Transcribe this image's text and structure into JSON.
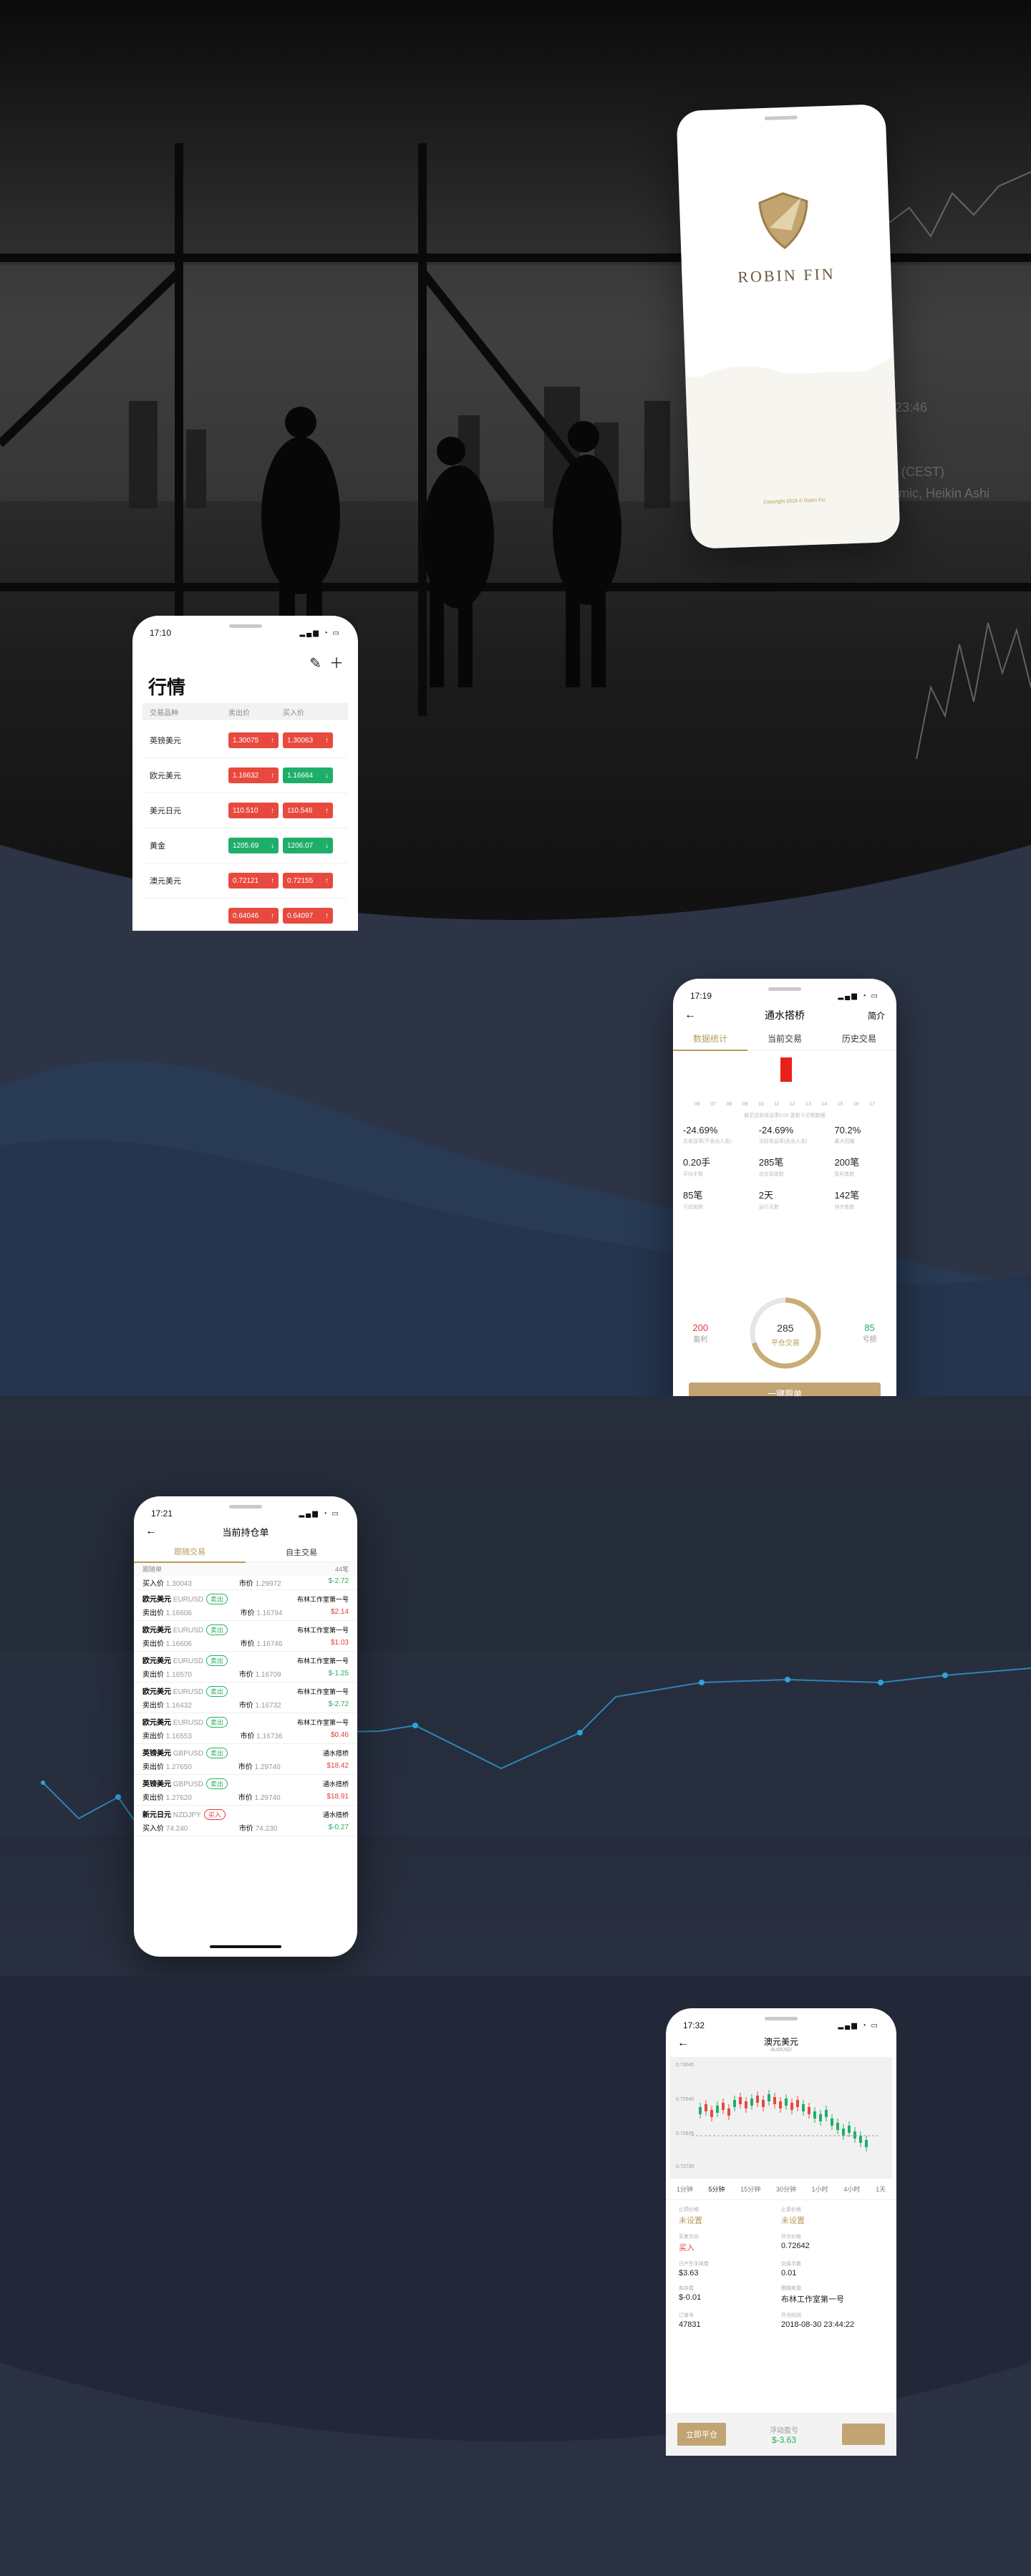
{
  "brand": {
    "name": "ROBIN FIN",
    "copyright": "Copyright 2018 © Robin Fin",
    "accent": "#b89a5c"
  },
  "backdrop": {
    "ticker": "23:46",
    "label1": "rithmic, Heikin Ashi",
    "label2": "gju (CEST)"
  },
  "market": {
    "time": "17:10",
    "title": "行情",
    "columns": [
      "交易品种",
      "卖出价",
      "买入价"
    ],
    "rows": [
      {
        "name": "英镑美元",
        "sell": "1.30075",
        "buy": "1.30063",
        "sell_dir": "↑",
        "buy_dir": "↑",
        "sell_c": "r",
        "buy_c": "r"
      },
      {
        "name": "欧元美元",
        "sell": "1.16632",
        "buy": "1.16664",
        "sell_dir": "↑",
        "buy_dir": "↓",
        "sell_c": "r",
        "buy_c": "g"
      },
      {
        "name": "美元日元",
        "sell": "110.510",
        "buy": "110.546",
        "sell_dir": "↑",
        "buy_dir": "↑",
        "sell_c": "r",
        "buy_c": "r"
      },
      {
        "name": "黄金",
        "sell": "1205.69",
        "buy": "1206.07",
        "sell_dir": "↓",
        "buy_dir": "↓",
        "sell_c": "g",
        "buy_c": "g"
      },
      {
        "name": "澳元美元",
        "sell": "0.72121",
        "buy": "0.72155",
        "sell_dir": "↑",
        "buy_dir": "↑",
        "sell_c": "r",
        "buy_c": "r"
      },
      {
        "name": "",
        "sell": "0.64046",
        "buy": "0.64097",
        "sell_dir": "↑",
        "buy_dir": "↑",
        "sell_c": "r",
        "buy_c": "r"
      }
    ]
  },
  "detail": {
    "time": "17:19",
    "title": "通水搭桥",
    "intro": "简介",
    "tabs": [
      "数据统计",
      "当前交易",
      "历史交易"
    ],
    "chart_note": "截至目前收益率0.00 更新于近期数据",
    "axis": [
      "06",
      "07",
      "08",
      "09",
      "10",
      "11",
      "12",
      "13",
      "14",
      "15",
      "16",
      "17"
    ],
    "stats": [
      {
        "v": "-24.69%",
        "l": "总收益率(不含出入金)"
      },
      {
        "v": "-24.69%",
        "l": "当前收益率(含出入金)"
      },
      {
        "v": "70.2%",
        "l": "最大回撤"
      },
      {
        "v": "0.20手",
        "l": "平均手数"
      },
      {
        "v": "285笔",
        "l": "总交易笔数"
      },
      {
        "v": "200笔",
        "l": "盈利笔数"
      },
      {
        "v": "85笔",
        "l": "亏损笔数"
      },
      {
        "v": "2天",
        "l": "运行天数"
      },
      {
        "v": "142笔",
        "l": "持仓笔数"
      }
    ],
    "ring_left": "200",
    "ring_left_l": "盈利",
    "ring_center": "285",
    "ring_center_l": "平仓交易",
    "ring_right": "85",
    "ring_right_l": "亏损",
    "ring_ratio": 0.7,
    "cta": "一键跟单"
  },
  "positions": {
    "time": "17:21",
    "title": "当前持仓单",
    "tabs": [
      "跟随交易",
      "自主交易"
    ],
    "header_l": "跟随单",
    "header_r": "44笔",
    "first": {
      "side": "买入价",
      "price": "1.30043",
      "type": "市价",
      "p2": "1.29972",
      "pl": "$-2.72"
    },
    "items": [
      {
        "name": "欧元美元",
        "code": "EURUSD",
        "tag": "卖出",
        "from": "布林工作室第一号",
        "side": "卖出价",
        "price": "1.16606",
        "type": "市价",
        "p2": "1.16794",
        "pl": "$2.14",
        "plc": "red",
        "tagc": "g"
      },
      {
        "name": "欧元美元",
        "code": "EURUSD",
        "tag": "卖出",
        "from": "布林工作室第一号",
        "side": "卖出价",
        "price": "1.16606",
        "type": "市价",
        "p2": "1.16746",
        "pl": "$1.03",
        "plc": "red",
        "tagc": "g"
      },
      {
        "name": "欧元美元",
        "code": "EURUSD",
        "tag": "卖出",
        "from": "布林工作室第一号",
        "side": "卖出价",
        "price": "1.16570",
        "type": "市价",
        "p2": "1.16709",
        "pl": "$-1.25",
        "plc": "green",
        "tagc": "g"
      },
      {
        "name": "欧元美元",
        "code": "EURUSD",
        "tag": "卖出",
        "from": "布林工作室第一号",
        "side": "卖出价",
        "price": "1.16432",
        "type": "市价",
        "p2": "1.16732",
        "pl": "$-2.72",
        "plc": "green",
        "tagc": "g"
      },
      {
        "name": "欧元美元",
        "code": "EURUSD",
        "tag": "卖出",
        "from": "布林工作室第一号",
        "side": "卖出价",
        "price": "1.16553",
        "type": "市价",
        "p2": "1.16736",
        "pl": "$0.46",
        "plc": "red",
        "tagc": "g"
      },
      {
        "name": "英镑美元",
        "code": "GBPUSD",
        "tag": "卖出",
        "from": "通水搭桥",
        "side": "卖出价",
        "price": "1.27650",
        "type": "市价",
        "p2": "1.29740",
        "pl": "$18.42",
        "plc": "red",
        "tagc": "g"
      },
      {
        "name": "英镑美元",
        "code": "GBPUSD",
        "tag": "卖出",
        "from": "通水搭桥",
        "side": "卖出价",
        "price": "1.27620",
        "type": "市价",
        "p2": "1.29740",
        "pl": "$18.91",
        "plc": "red",
        "tagc": "g"
      },
      {
        "name": "新元日元",
        "code": "NZDJPY",
        "tag": "买入",
        "from": "通水搭桥",
        "side": "买入价",
        "price": "74.240",
        "type": "市价",
        "p2": "74.230",
        "pl": "$-0.27",
        "plc": "green",
        "tagc": "r"
      }
    ]
  },
  "order": {
    "time": "17:32",
    "title": "澳元美元",
    "subtitle": "AUDUSD",
    "prices": [
      "0.73045",
      "0.72940",
      "0.72835",
      "0.72730"
    ],
    "periods": [
      "1分钟",
      "5分钟",
      "15分钟",
      "30分钟",
      "1小时",
      "4小时",
      "1天"
    ],
    "fields": [
      {
        "l": "止损价格",
        "v": "未设置",
        "c": "gold"
      },
      {
        "l": "止盈价格",
        "v": "未设置",
        "c": "gold"
      },
      {
        "l": "买卖方向",
        "v": "买入",
        "c": "red"
      },
      {
        "l": "开仓价格",
        "v": "0.72642",
        "c": ""
      },
      {
        "l": "已产生手续费",
        "v": "$3.63",
        "c": ""
      },
      {
        "l": "交易手数",
        "v": "0.01",
        "c": ""
      },
      {
        "l": "库存费",
        "v": "$-0.01",
        "c": ""
      },
      {
        "l": "跟随来源",
        "v": "布林工作室第一号",
        "c": ""
      },
      {
        "l": "订单号",
        "v": "47831",
        "c": ""
      },
      {
        "l": "开仓时间",
        "v": "2018-08-30 23:44:22",
        "c": ""
      }
    ],
    "close_btn": "立即平仓",
    "pl_label": "浮动盈亏",
    "pl": "$-3.63"
  }
}
